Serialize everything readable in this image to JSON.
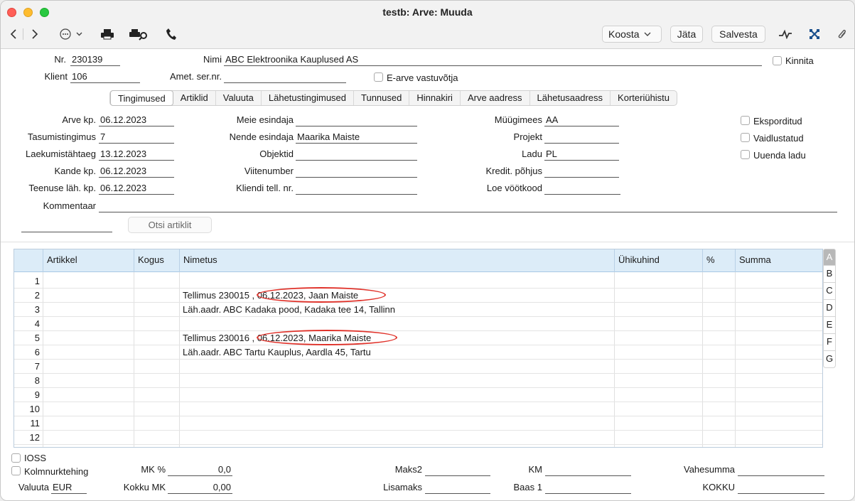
{
  "window": {
    "title": "testb: Arve: Muuda"
  },
  "toolbar": {
    "koosta": "Koosta",
    "jata": "Jäta",
    "salvesta": "Salvesta"
  },
  "header": {
    "nr_label": "Nr.",
    "nr_value": "230139",
    "nimi_label": "Nimi",
    "nimi_value": "ABC Elektroonika Kauplused AS",
    "kinnita_label": "Kinnita",
    "klient_label": "Klient",
    "klient_value": "106",
    "amet_label": "Amet. ser.nr.",
    "amet_value": "",
    "earve_label": "E-arve vastuvõtja"
  },
  "tabs": [
    "Tingimused",
    "Artiklid",
    "Valuuta",
    "Lähetustingimused",
    "Tunnused",
    "Hinnakiri",
    "Arve aadress",
    "Lähetusaadress",
    "Korteriühistu"
  ],
  "conditions": {
    "arve_kp_label": "Arve kp.",
    "arve_kp": "06.12.2023",
    "tasum_label": "Tasumistingimus",
    "tasum": "7",
    "laek_label": "Laekumistähtaeg",
    "laek": "13.12.2023",
    "kande_label": "Kande kp.",
    "kande": "06.12.2023",
    "teenuse_label": "Teenuse läh. kp.",
    "teenuse": "06.12.2023",
    "meie_label": "Meie esindaja",
    "meie": "",
    "nende_label": "Nende esindaja",
    "nende": "Maarika Maiste",
    "objektid_label": "Objektid",
    "objektid": "",
    "viite_label": "Viitenumber",
    "viite": "",
    "klt_label": "Kliendi tell. nr.",
    "klt": "",
    "myygi_label": "Müügimees",
    "myygi": "AA",
    "projekt_label": "Projekt",
    "projekt": "",
    "ladu_label": "Ladu",
    "ladu": "PL",
    "kredit_label": "Kredit. põhjus",
    "kredit": "",
    "loe_label": "Loe vöötkood",
    "loe": "",
    "eksp_label": "Eksporditud",
    "vaid_label": "Vaidlustatud",
    "uuenda_label": "Uuenda ladu",
    "komment_label": "Kommentaar",
    "komment": "",
    "otsi_label": "Otsi artiklit"
  },
  "grid": {
    "columns": [
      "Artikkel",
      "Kogus",
      "Nimetus",
      "Ühikuhind",
      "%",
      "Summa"
    ],
    "rows": [
      {
        "n": "1",
        "nimetus": ""
      },
      {
        "n": "2",
        "nimetus": "Tellimus 230015 , 06.12.2023, Jaan Maiste"
      },
      {
        "n": "3",
        "nimetus": "Läh.aadr. ABC Kadaka pood, Kadaka tee 14, Tallinn"
      },
      {
        "n": "4",
        "nimetus": ""
      },
      {
        "n": "5",
        "nimetus": "Tellimus 230016 , 06.12.2023, Maarika Maiste"
      },
      {
        "n": "6",
        "nimetus": "Läh.aadr. ABC Tartu Kauplus, Aardla 45, Tartu"
      },
      {
        "n": "7",
        "nimetus": ""
      },
      {
        "n": "8",
        "nimetus": ""
      },
      {
        "n": "9",
        "nimetus": ""
      },
      {
        "n": "10",
        "nimetus": ""
      },
      {
        "n": "11",
        "nimetus": ""
      },
      {
        "n": "12",
        "nimetus": ""
      }
    ],
    "side_tabs": [
      "A",
      "B",
      "C",
      "D",
      "E",
      "F",
      "G"
    ]
  },
  "footer": {
    "ioss_label": "IOSS",
    "kolm_label": "Kolmnurktehing",
    "valuuta_label": "Valuuta",
    "valuuta": "EUR",
    "mk_label": "MK %",
    "mk": "0,0",
    "kokku_mk_label": "Kokku MK",
    "kokku_mk": "0,00",
    "maks2_label": "Maks2",
    "maks2": "",
    "lisamaks_label": "Lisamaks",
    "lisamaks": "",
    "km_label": "KM",
    "km": "",
    "baas_label": "Baas 1",
    "baas": "",
    "vahesumma_label": "Vahesumma",
    "vahesumma": "",
    "kokku_label": "KOKKU",
    "kokku": ""
  }
}
